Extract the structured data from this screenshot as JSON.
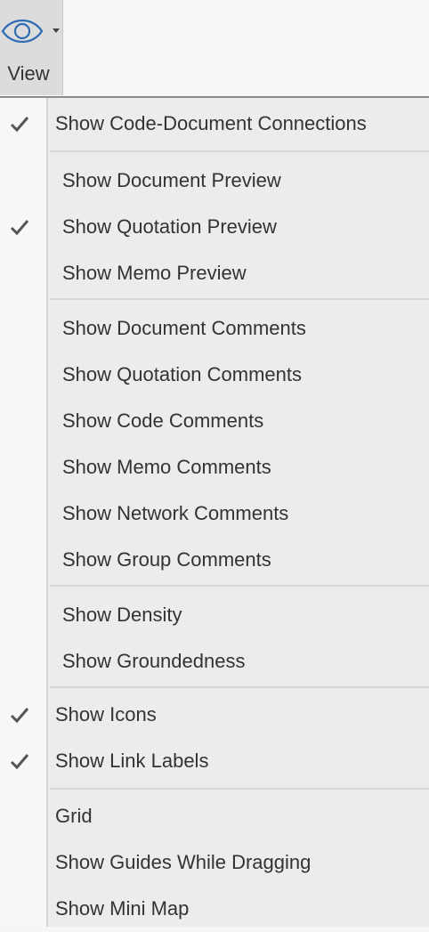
{
  "toolbar": {
    "view_label": "View",
    "view_icon": "eye-icon",
    "dropdown_icon": "caret-down-icon"
  },
  "menu": {
    "check_icon": "checkmark-icon",
    "items": [
      {
        "label": "Show Code-Document Connections",
        "checked": true
      },
      {
        "label": "Show Document Preview",
        "checked": false
      },
      {
        "label": "Show Quotation Preview",
        "checked": true
      },
      {
        "label": "Show Memo Preview",
        "checked": false
      },
      {
        "label": "Show Document Comments",
        "checked": false
      },
      {
        "label": "Show Quotation Comments",
        "checked": false
      },
      {
        "label": "Show Code Comments",
        "checked": false
      },
      {
        "label": "Show Memo Comments",
        "checked": false
      },
      {
        "label": "Show Network Comments",
        "checked": false
      },
      {
        "label": "Show Group Comments",
        "checked": false
      },
      {
        "label": "Show Density",
        "checked": false
      },
      {
        "label": "Show Groundedness",
        "checked": false
      },
      {
        "label": "Show Icons",
        "checked": true
      },
      {
        "label": "Show Link Labels",
        "checked": true
      },
      {
        "label": "Grid",
        "checked": false
      },
      {
        "label": "Show Guides While Dragging",
        "checked": false
      },
      {
        "label": "Show Mini Map",
        "checked": false
      }
    ]
  }
}
